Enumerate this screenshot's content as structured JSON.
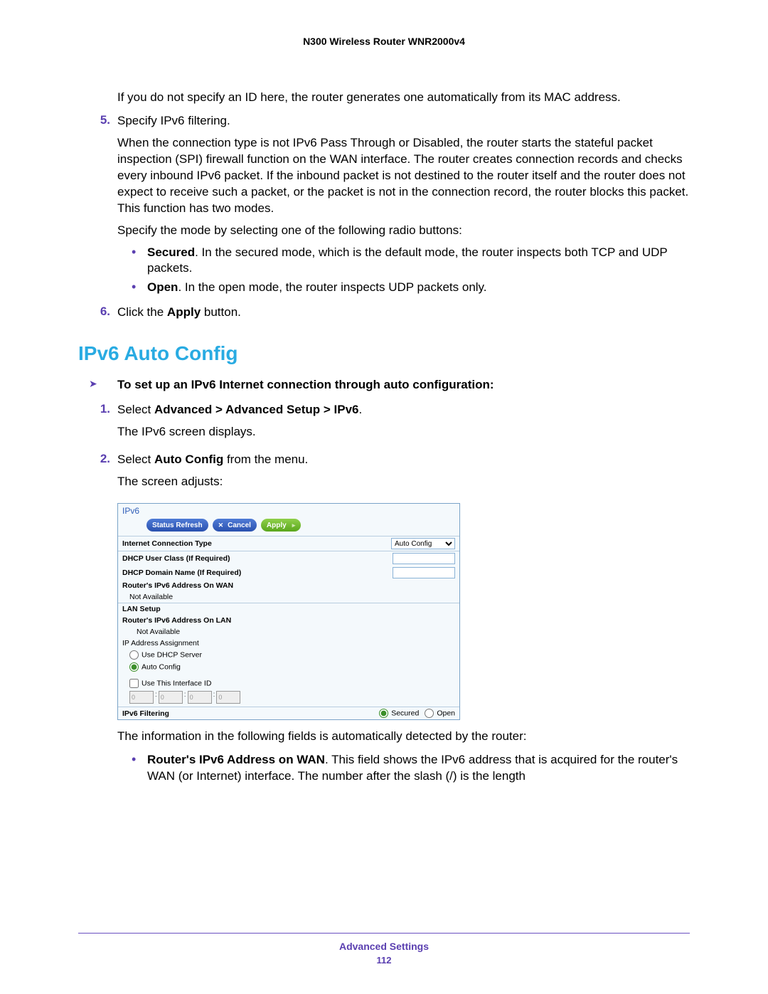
{
  "header": {
    "title": "N300 Wireless Router WNR2000v4"
  },
  "intro_para": "If you do not specify an ID here, the router generates one automatically from its MAC address.",
  "step5": {
    "num": "5.",
    "lead": "Specify IPv6 filtering.",
    "p1": "When the connection type is not IPv6 Pass Through or Disabled, the router starts the stateful packet inspection (SPI) firewall function on the WAN interface. The router creates connection records and checks every inbound IPv6 packet. If the inbound packet is not destined to the router itself and the router does not expect to receive such a packet, or the packet is not in the connection record, the router blocks this packet. This function has two modes.",
    "p2": "Specify the mode by selecting one of the following radio buttons:",
    "b1_bold": "Secured",
    "b1_rest": ". In the secured mode, which is the default mode, the router inspects both TCP and UDP packets.",
    "b2_bold": "Open",
    "b2_rest": ". In the open mode, the router inspects UDP packets only."
  },
  "step6": {
    "num": "6.",
    "pre": "Click the ",
    "bold": "Apply",
    "post": " button."
  },
  "section_title": "IPv6 Auto Config",
  "task": "To set up an IPv6 Internet connection through auto configuration:",
  "s1": {
    "num": "1.",
    "pre": "Select ",
    "bold": "Advanced > Advanced Setup > IPv6",
    "post": ".",
    "p": "The IPv6 screen displays."
  },
  "s2": {
    "num": "2.",
    "pre": "Select ",
    "bold": "Auto Config",
    "post": " from the menu.",
    "p": "The screen adjusts:"
  },
  "shot": {
    "title": "IPv6",
    "btn_refresh": "Status Refresh",
    "btn_cancel": "Cancel",
    "btn_apply": "Apply",
    "ict_label": "Internet Connection Type",
    "ict_value": "Auto Config",
    "dhcp_user": "DHCP User Class (If Required)",
    "dhcp_domain": "DHCP Domain Name  (If Required)",
    "wan_addr": "Router's IPv6 Address On WAN",
    "not_avail": "Not Available",
    "lan_setup": "LAN Setup",
    "lan_addr": "Router's IPv6 Address On LAN",
    "ip_assign": "IP Address Assignment",
    "opt_dhcp": "Use DHCP Server",
    "opt_auto": "Auto Config",
    "use_iid": "Use This Interface ID",
    "iid": [
      "0",
      "0",
      "0",
      "0"
    ],
    "filt_label": "IPv6 Filtering",
    "filt_secured": "Secured",
    "filt_open": "Open"
  },
  "after1": "The information in the following fields is automatically detected by the router:",
  "after_b_bold": "Router's IPv6 Address on WAN",
  "after_b_rest": ". This field shows the IPv6 address that is acquired for the router's WAN (or Internet) interface. The number after the slash (/) is the length",
  "footer": {
    "section": "Advanced Settings",
    "page": "112"
  }
}
